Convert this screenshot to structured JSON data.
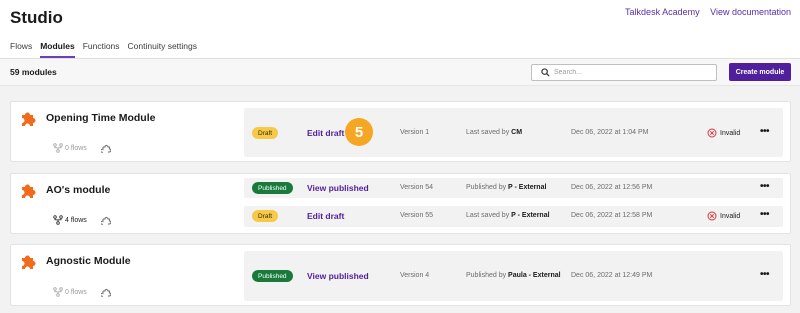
{
  "app": {
    "title": "Studio"
  },
  "top_links": {
    "academy": "Talkdesk Academy",
    "docs": "View documentation"
  },
  "tabs": [
    {
      "label": "Flows",
      "active": false
    },
    {
      "label": "Modules",
      "active": true
    },
    {
      "label": "Functions",
      "active": false
    },
    {
      "label": "Continuity settings",
      "active": false
    }
  ],
  "toolbar": {
    "count_label": "59 modules",
    "search_placeholder": "Search...",
    "create_label": "Create module"
  },
  "colors": {
    "accent": "#4f1f9c",
    "draft": "#f7c948",
    "published": "#1a7a3c",
    "invalid": "#d9363e",
    "module_icon": "#f26b1d",
    "step_marker": "#f5a623"
  },
  "step_marker": "5",
  "modules": [
    {
      "name": "Opening Time Module",
      "flows": "0 flows",
      "versions": [
        {
          "badge": "Draft",
          "action": "Edit draft",
          "version": "Version 1",
          "saved_prefix": "Last saved by ",
          "saved_by": "CM",
          "date": "Dec 06, 2022 at 1:04 PM",
          "status": "Invalid",
          "more": "•••"
        }
      ]
    },
    {
      "name": "AO's module",
      "flows": "4 flows",
      "versions": [
        {
          "badge": "Published",
          "action": "View published",
          "version": "Version 54",
          "saved_prefix": "Published by ",
          "saved_by": "P - External",
          "date": "Dec 06, 2022 at 12:56 PM",
          "status": "",
          "more": "•••"
        },
        {
          "badge": "Draft",
          "action": "Edit draft",
          "version": "Version 55",
          "saved_prefix": "Last saved by ",
          "saved_by": "P - External",
          "date": "Dec 06, 2022 at 12:58 PM",
          "status": "Invalid",
          "more": "•••"
        }
      ]
    },
    {
      "name": "Agnostic Module",
      "flows": "0 flows",
      "versions": [
        {
          "badge": "Published",
          "action": "View published",
          "version": "Version 4",
          "saved_prefix": "Published by ",
          "saved_by": "Paula - External",
          "date": "Dec 06, 2022 at 12:49 PM",
          "status": "",
          "more": "•••"
        }
      ]
    }
  ]
}
